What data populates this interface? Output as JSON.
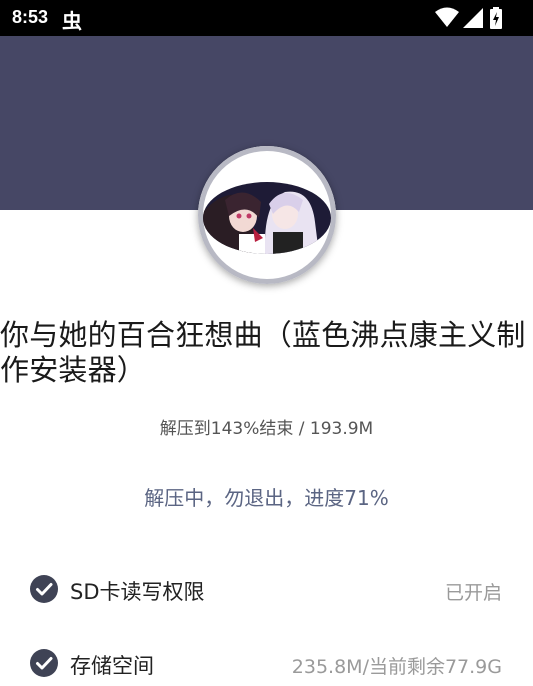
{
  "status_bar": {
    "time": "8:53",
    "notification_icon": "bug-icon",
    "notification_glyph": "虫",
    "icons": [
      "wifi-icon",
      "signal-icon",
      "battery-charging-icon"
    ]
  },
  "header": {
    "band_color": "#464765",
    "avatar": "app-icon-anime-artwork"
  },
  "app": {
    "title": "你与她的百合狂想曲（蓝色沸点康主义制作安装器）"
  },
  "progress": {
    "info": "解压到143%结束 / 193.9M",
    "status": "解压中，勿退出，进度71%",
    "percent": 71
  },
  "permissions": [
    {
      "icon": "check-circle-icon",
      "label": "SD卡读写权限",
      "value": "已开启"
    },
    {
      "icon": "check-circle-icon",
      "label": "存储空间",
      "value": "235.8M/当前剩余77.9G"
    }
  ],
  "colors": {
    "accent": "#5b6583",
    "check": "#3f4355",
    "header": "#464765"
  }
}
